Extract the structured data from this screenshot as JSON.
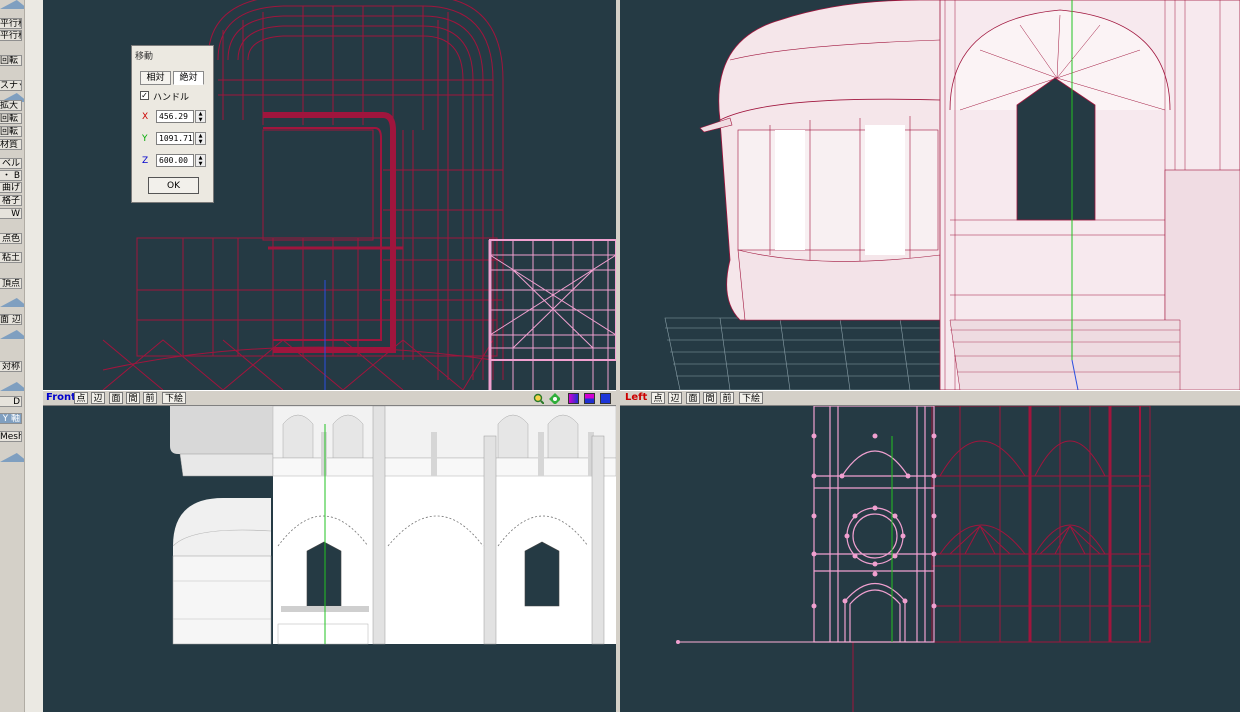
{
  "left_toolbar": {
    "buttons": [
      "平行移動 G",
      "回転 C",
      "スナッピング",
      "拡大 P",
      "回転 F",
      "回転 I",
      "材質 M",
      "ベル",
      "・ B",
      "曲げ",
      "格子",
      "W",
      "点色",
      "粘土",
      "頂点",
      "面 辺",
      "対称",
      "D",
      "Y 軸",
      "Mesh"
    ]
  },
  "move_dialog": {
    "title": "移動",
    "tab_relative": "相対",
    "tab_absolute": "絶対",
    "handle_checked": "✓",
    "handle_label": "ハンドル",
    "x_label": "X",
    "x_value": "456.29",
    "y_label": "Y",
    "y_value": "1091.71",
    "z_label": "Z",
    "z_value": "600.00",
    "ok_label": "OK"
  },
  "viewports": {
    "front": {
      "name": "Front",
      "modes": [
        "点",
        "辺",
        "面",
        "間",
        "前",
        "下絵"
      ]
    },
    "left": {
      "name": "Left",
      "modes": [
        "点",
        "辺",
        "面",
        "間",
        "前",
        "下絵"
      ]
    }
  },
  "colors": {
    "viewport_bg": "#253a44",
    "wire_red": "#a0153d",
    "wire_pink": "#f0a0d0",
    "mesh_white": "#ffffff",
    "axis_green": "#22c322",
    "axis_blue": "#2a4ee0",
    "view_name_front": "#0000cc",
    "view_name_left": "#cc0000"
  }
}
